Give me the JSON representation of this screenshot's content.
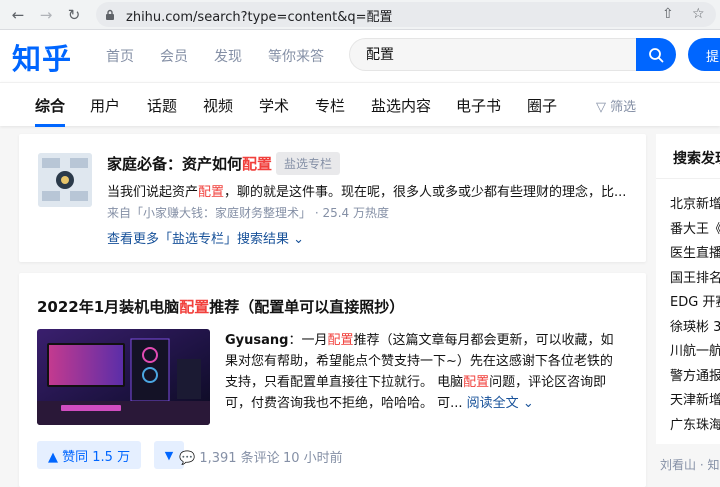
{
  "browser": {
    "url": "zhihu.com/search?type=content&q=配置"
  },
  "header": {
    "logo": "知乎",
    "nav": [
      "首页",
      "会员",
      "发现",
      "等你来答"
    ],
    "search_value": "配置",
    "ask_label": "提"
  },
  "tabs": {
    "items": [
      "综合",
      "用户",
      "话题",
      "视频",
      "学术",
      "专栏",
      "盐选内容",
      "电子书",
      "圈子"
    ],
    "filter_label": "筛选"
  },
  "card1": {
    "title_prefix": "家庭必备：资产如何",
    "title_highlight": "配置",
    "tag": "盐选专栏",
    "desc_prefix": "当我们说起资产",
    "desc_highlight": "配置",
    "desc_suffix": "，聊的就是这件事。现在呢，很多人或多或少都有些理财的理念，比...",
    "source": "来自「小家赚大钱：家庭财务整理术」 · 25.4 万热度",
    "more_link": "查看更多「盐选专栏」搜索结果"
  },
  "card2": {
    "title_a": "2022年1月装机电脑",
    "title_highlight": "配置",
    "title_b": "推荐（配置单可以直接照抄）",
    "author": "Gyusang",
    "ex_1": "：一月",
    "ex_hl1": "配置",
    "ex_2": "推荐（这篇文章每月都会更新，可以收藏，如果对您有帮助，希望能点个赞支持一下~）先在这感谢下各位老铁的支持，只看配置单直接往下拉就行。 电脑",
    "ex_hl2": "配置",
    "ex_3": "问题，评论区咨询即可，付费咨询我也不拒绝，哈哈哈。 可... ",
    "read_more": "阅读全文",
    "vote_label": "赞同 1.5 万",
    "comments": "1,391 条评论",
    "time": "10 小时前"
  },
  "sidebar": {
    "title": "搜索发现",
    "items": [
      "北京新增",
      "番大王《",
      "医生直播",
      "国王排名",
      "EDG 开赛",
      "徐瑛彬 3",
      "川航一航",
      "警方通报",
      "天津新增",
      "广东珠海"
    ],
    "footer": "刘看山 · 知"
  },
  "colors": {
    "brand": "#0066ff",
    "highlight": "#f1403c",
    "link": "#175199",
    "muted": "#8590a6"
  }
}
